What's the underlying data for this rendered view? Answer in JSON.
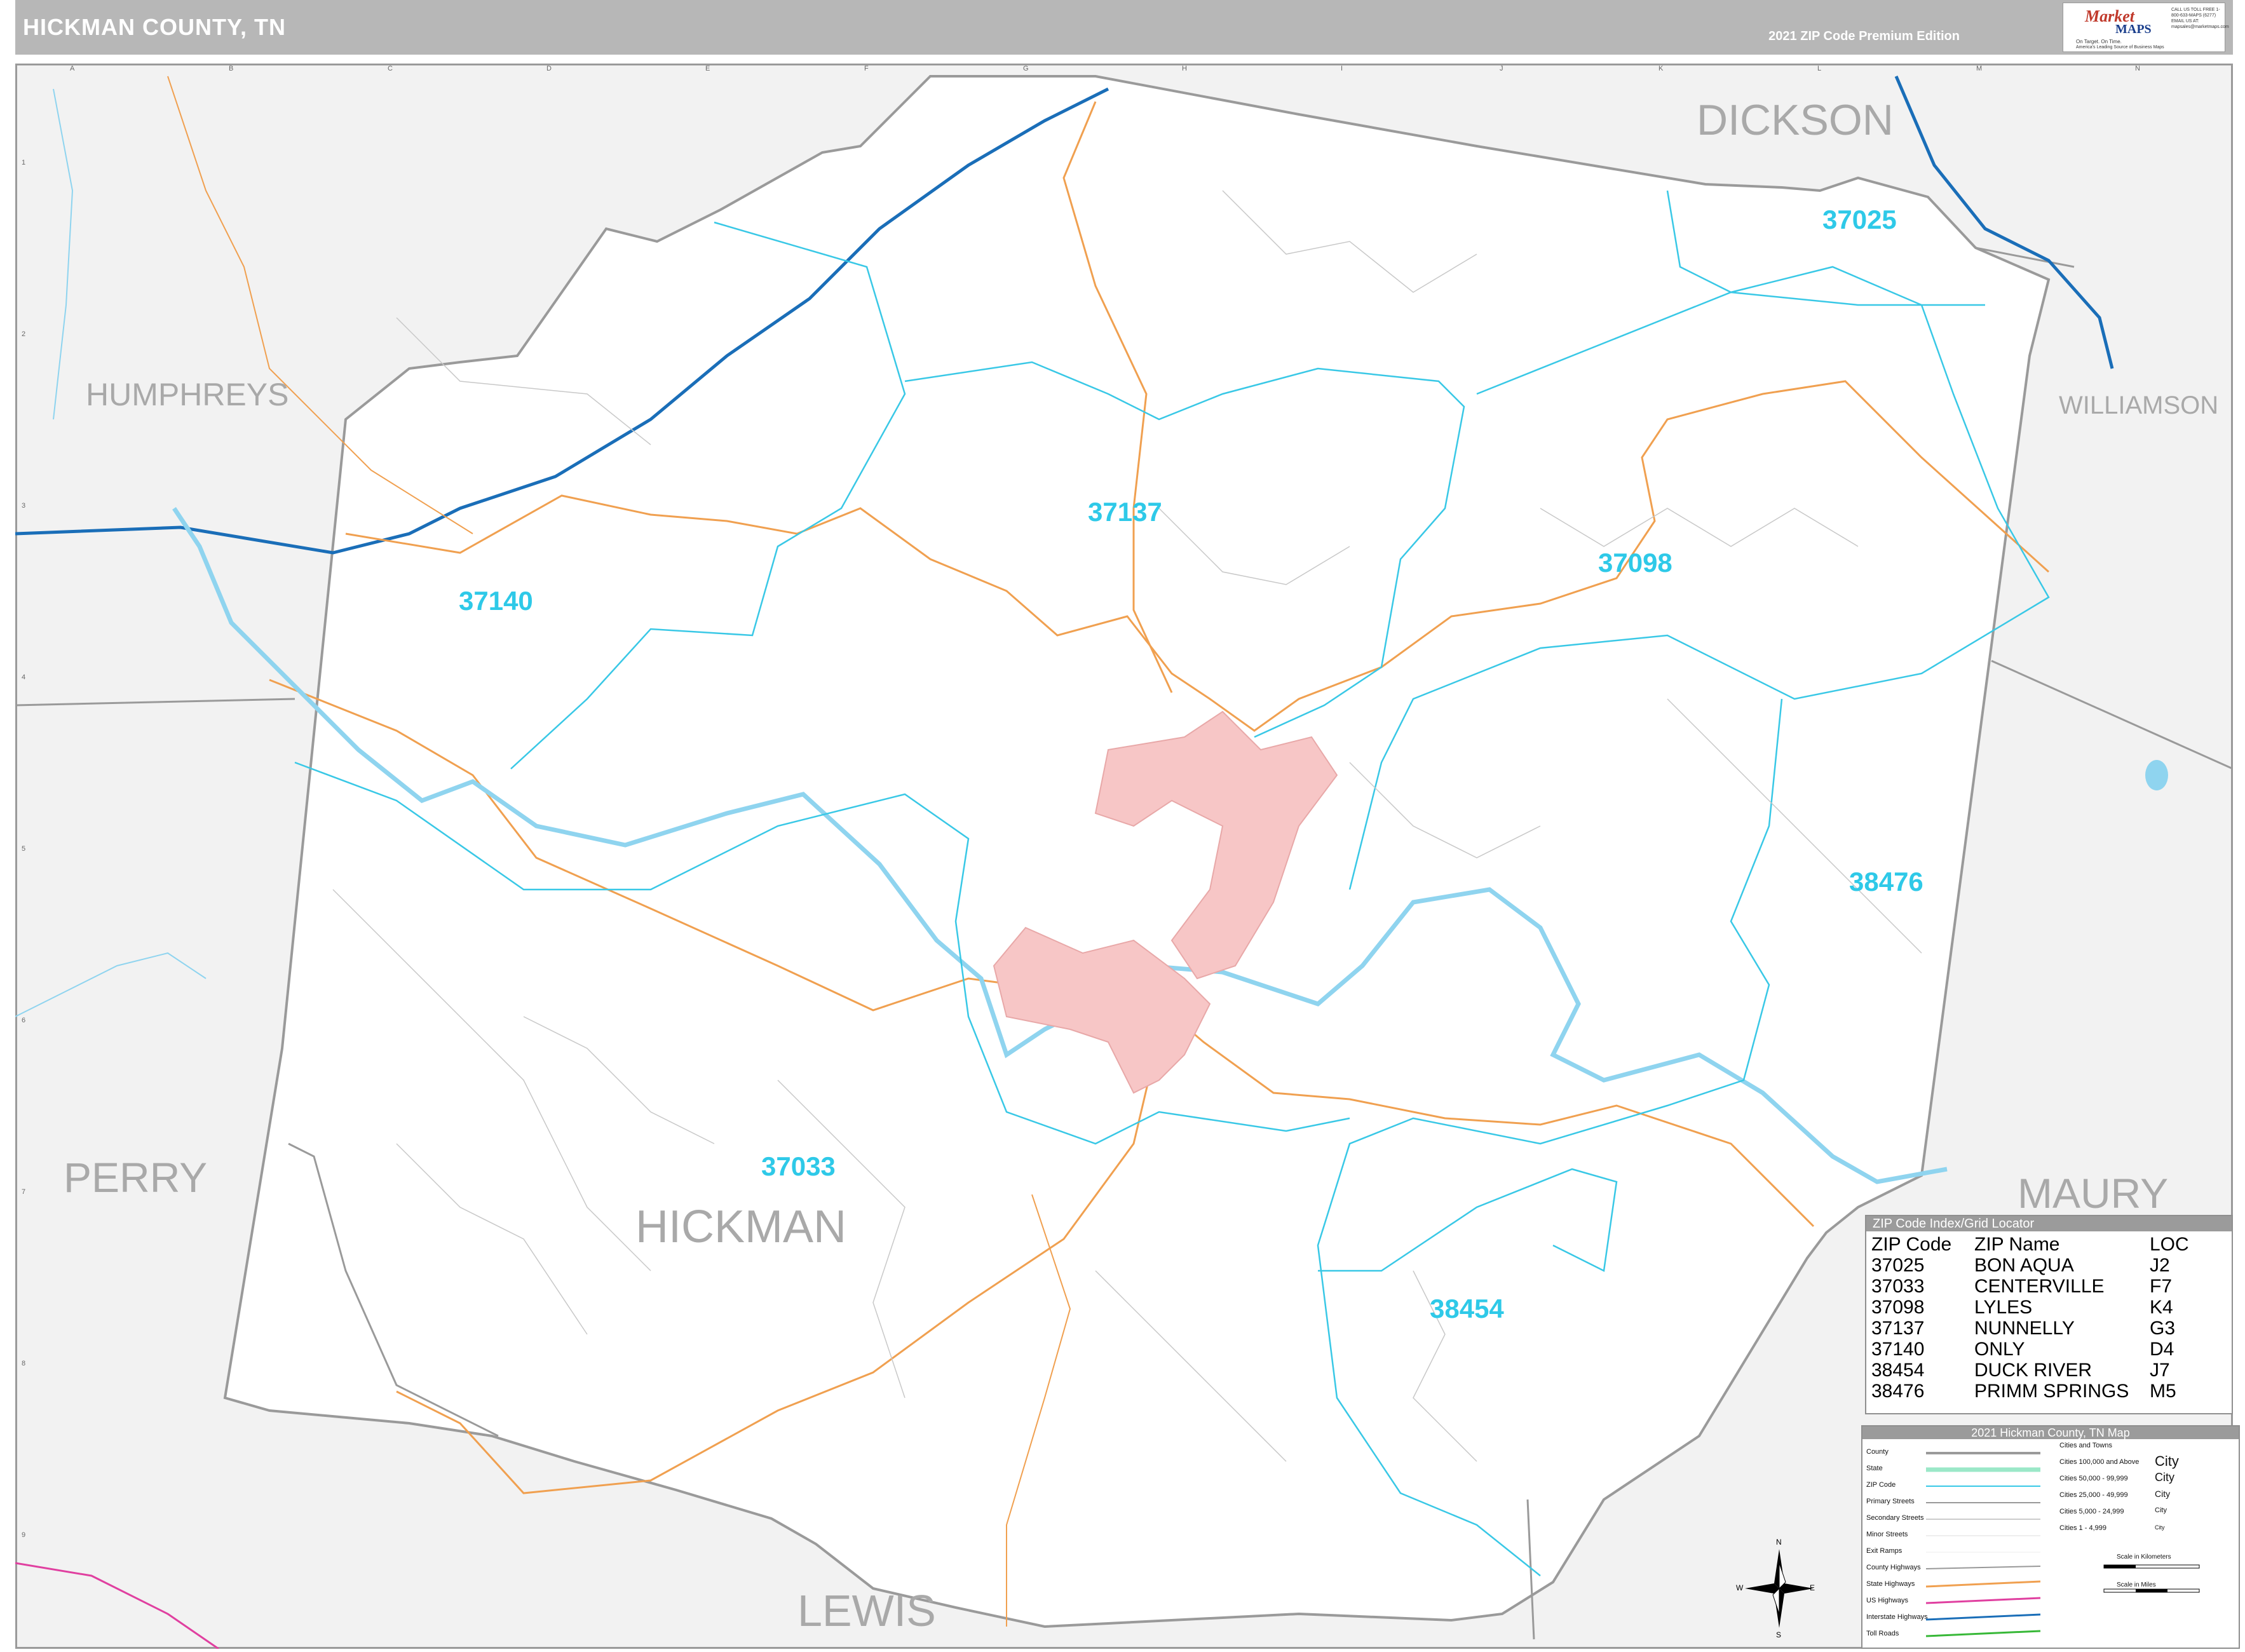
{
  "header": {
    "title": "HICKMAN COUNTY, TN",
    "edition": "2021 ZIP Code Premium Edition"
  },
  "logo": {
    "brand": "Market",
    "brand2": "MAPS",
    "tagline": "On Target. On Time.",
    "tagline2": "America's Leading Source of Business Maps",
    "contact": "CALL US TOLL FREE 1-800-633-MAPS (6277) EMAIL US AT: mapsales@marketmaps.com"
  },
  "grid": {
    "letters": [
      "A",
      "B",
      "C",
      "D",
      "E",
      "F",
      "G",
      "H",
      "I",
      "J",
      "K",
      "L",
      "M",
      "N"
    ],
    "numbers": [
      "1",
      "2",
      "3",
      "4",
      "5",
      "6",
      "7",
      "8",
      "9"
    ]
  },
  "counties": {
    "main": "HICKMAN",
    "neighbors": [
      "DICKSON",
      "HUMPHREYS",
      "WILLIAMSON",
      "PERRY",
      "MAURY",
      "LEWIS"
    ]
  },
  "zip_labels": [
    "37025",
    "37137",
    "37098",
    "37140",
    "38476",
    "37033",
    "38454"
  ],
  "zip_index": {
    "title": "ZIP Code Index/Grid Locator",
    "headers": [
      "ZIP Code",
      "ZIP Name",
      "LOC"
    ],
    "rows": [
      [
        "37025",
        "BON AQUA",
        "J2"
      ],
      [
        "37033",
        "CENTERVILLE",
        "F7"
      ],
      [
        "37098",
        "LYLES",
        "K4"
      ],
      [
        "37137",
        "NUNNELLY",
        "G3"
      ],
      [
        "37140",
        "ONLY",
        "D4"
      ],
      [
        "38454",
        "DUCK RIVER",
        "J7"
      ],
      [
        "38476",
        "PRIMM SPRINGS",
        "M5"
      ]
    ]
  },
  "legend": {
    "title": "2021 Hickman County, TN Map",
    "items": [
      "County",
      "State",
      "ZIP Code",
      "Primary Streets",
      "Secondary Streets",
      "Minor Streets",
      "Exit Ramps",
      "County Highways",
      "State Highways",
      "US Highways",
      "Interstate Highways",
      "Toll Roads"
    ],
    "cities_header": "Cities and Towns",
    "cities": [
      [
        "Cities 100,000 and Above",
        "City"
      ],
      [
        "Cities 50,000 - 99,999",
        "City"
      ],
      [
        "Cities 25,000 - 49,999",
        "City"
      ],
      [
        "Cities 5,000 - 24,999",
        "City"
      ],
      [
        "Cities 1 - 4,999",
        "City"
      ]
    ],
    "scale_km": "Scale in Kilometers",
    "scale_mi": "Scale in Miles",
    "colors": {
      "county": "#9a9a9a",
      "state": "#9be8c8",
      "zip": "#39c8e6",
      "state_hwy": "#f0a050",
      "us_hwy": "#e040a0",
      "interstate": "#1a6eb8",
      "toll": "#38b838"
    }
  },
  "compass": {
    "n": "N",
    "s": "S",
    "e": "E",
    "w": "W"
  }
}
